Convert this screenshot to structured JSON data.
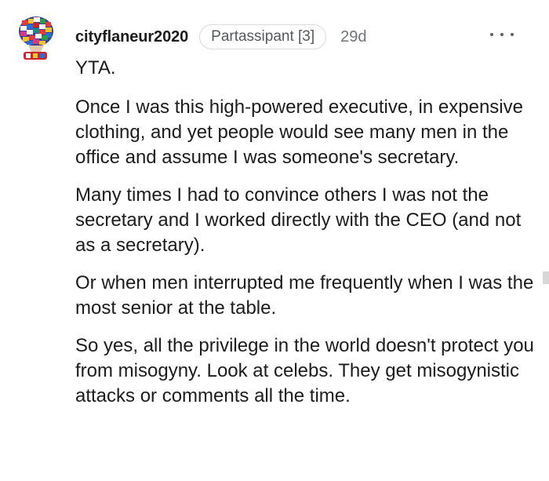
{
  "comment": {
    "username": "cityflaneur2020",
    "flair": "Partassipant [3]",
    "timestamp": "29d",
    "more_icon": "ellipsis-horizontal-icon",
    "avatar_icon": "user-avatar-icon",
    "paragraphs": [
      "YTA.",
      "Once I was this high-powered executive, in expensive clothing, and yet people would see many men in the office and assume I was someone's secretary.",
      "Many times I had to convince others I was not the secretary and I worked directly with the CEO (and not as a secretary).",
      "Or when men interrupted me frequently when I was the most senior at the table.",
      "So yes, all the privilege in the world doesn't protect you from misogyny. Look at celebs. They get misogynistic attacks or comments all the time."
    ]
  },
  "colors": {
    "text": "#1c1c1c",
    "meta": "#707579",
    "flair_border": "#d8dadc"
  }
}
